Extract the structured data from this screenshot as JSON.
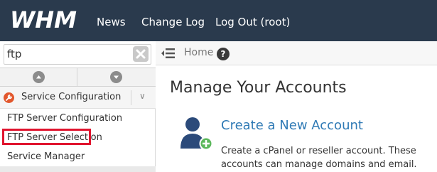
{
  "header": {
    "logo_text": "WHM",
    "nav": [
      "News",
      "Change Log",
      "Log Out (root)"
    ]
  },
  "sidebar": {
    "search_value": "ftp",
    "category": "Service Configuration",
    "items": [
      "FTP Server Configuration",
      "FTP Server Selection",
      "Service Manager"
    ]
  },
  "breadcrumb": {
    "home": "Home",
    "help_glyph": "?"
  },
  "main": {
    "title": "Manage Your Accounts",
    "link": "Create a New Account",
    "description": "Create a cPanel or reseller account. These accounts can manage domains and email."
  },
  "colors": {
    "topbar": "#2a3a4d",
    "link": "#2f7ab5",
    "highlight": "#e0142e",
    "accent_orange": "#e2572d"
  }
}
